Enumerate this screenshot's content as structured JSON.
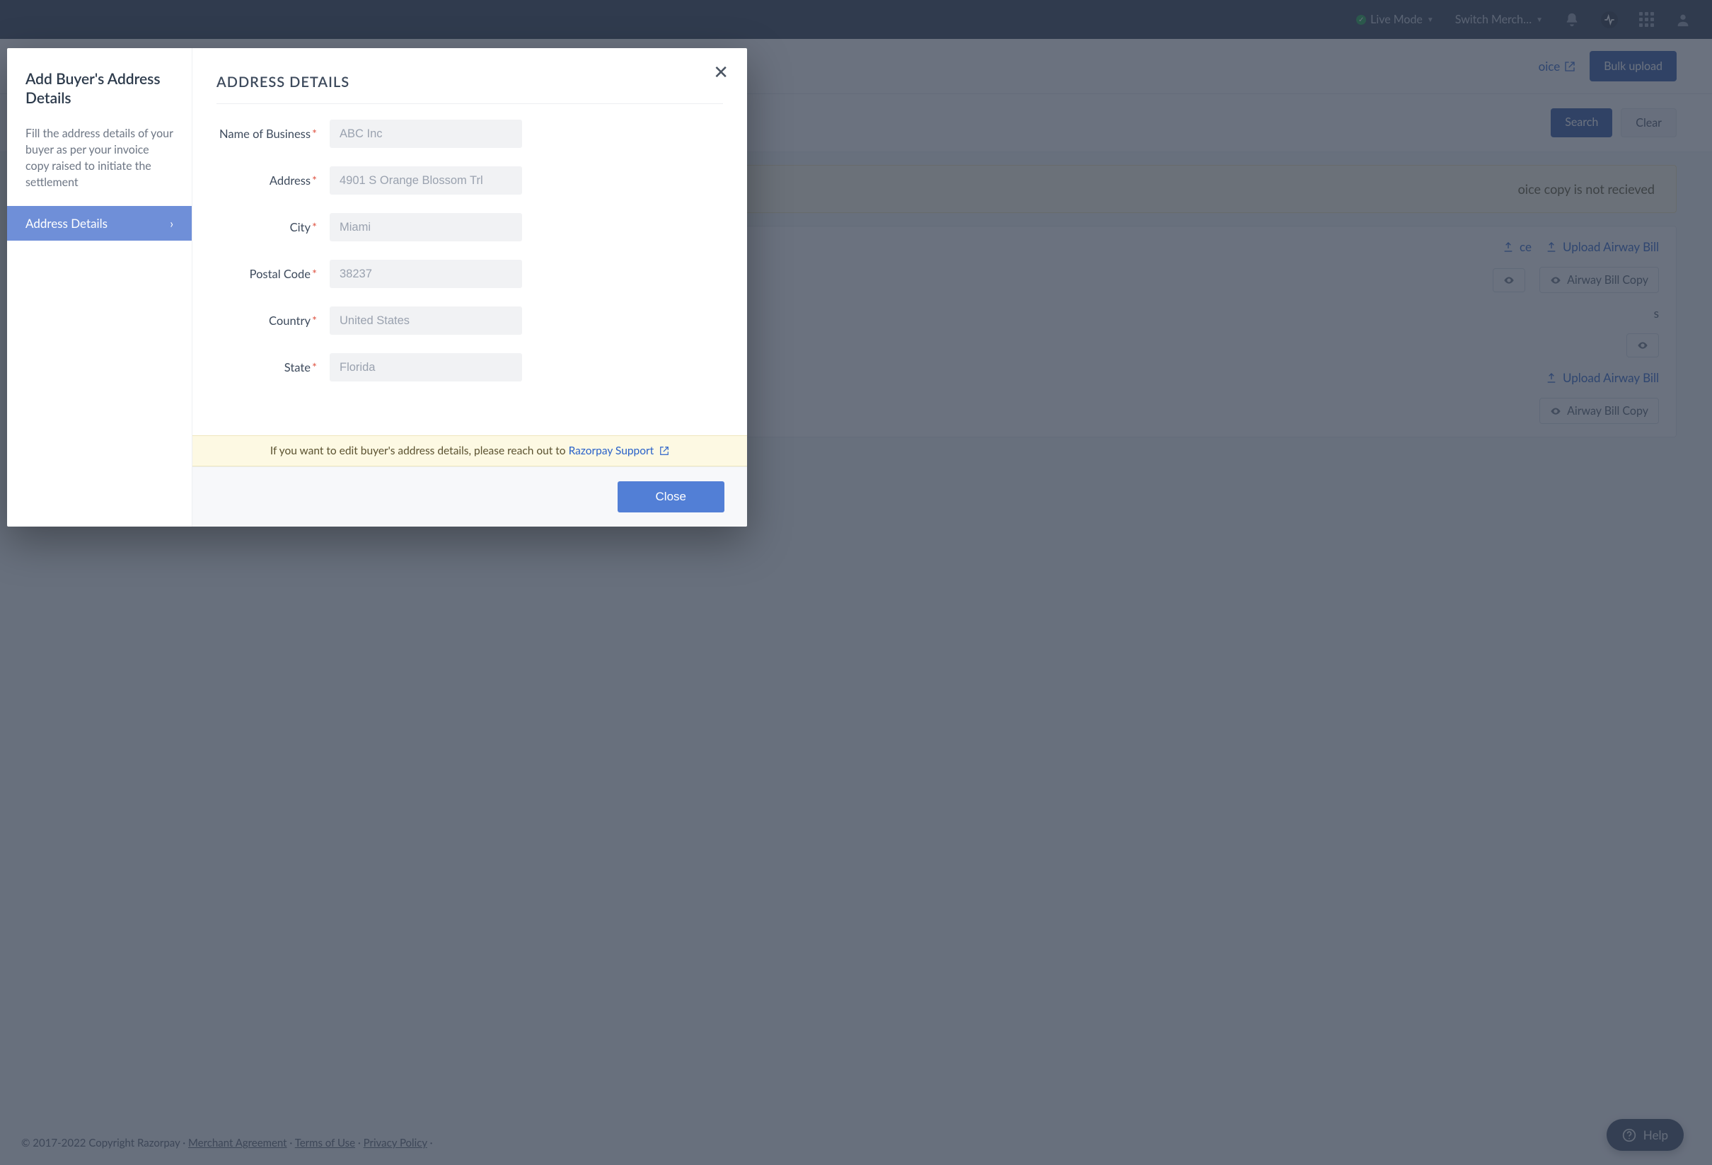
{
  "topbar": {
    "live_mode_label": "Live Mode",
    "switch_merchant_label": "Switch Merch…"
  },
  "secondary": {
    "invoice_link": "oice",
    "bulk_upload": "Bulk upload"
  },
  "filters": {
    "search": "Search",
    "clear": "Clear"
  },
  "notice": "oice copy is not recieved",
  "card1": {
    "upload_invoice": "ce",
    "upload_airway": "Upload Airway Bill",
    "airway_chip": "Airway Bill Copy",
    "middle_text": "s"
  },
  "card2": {
    "upload_airway": "Upload Airway Bill",
    "airway_chip": "Airway Bill Copy"
  },
  "footer": {
    "copyright": "© 2017-2022 Copyright Razorpay · ",
    "merchant_agreement": "Merchant Agreement",
    "terms": "Terms of Use",
    "privacy": "Privacy Policy",
    "sep": " · "
  },
  "help": {
    "label": "Help"
  },
  "modal": {
    "side_title": "Add Buyer's Address Details",
    "side_desc": "Fill the address details of your buyer as per your invoice copy raised to initiate the settlement",
    "step_label": "Address Details",
    "section_title": "ADDRESS DETAILS",
    "fields": {
      "business": {
        "label": "Name of Business",
        "placeholder": "ABC Inc"
      },
      "address": {
        "label": "Address",
        "placeholder": "4901 S Orange Blossom Trl"
      },
      "city": {
        "label": "City",
        "placeholder": "Miami"
      },
      "postal": {
        "label": "Postal Code",
        "placeholder": "38237"
      },
      "country": {
        "label": "Country",
        "placeholder": "United States"
      },
      "state": {
        "label": "State",
        "placeholder": "Florida"
      }
    },
    "info_prefix": "If you want to edit buyer's address details, please reach out to ",
    "info_link": "Razorpay Support",
    "close": "Close"
  }
}
